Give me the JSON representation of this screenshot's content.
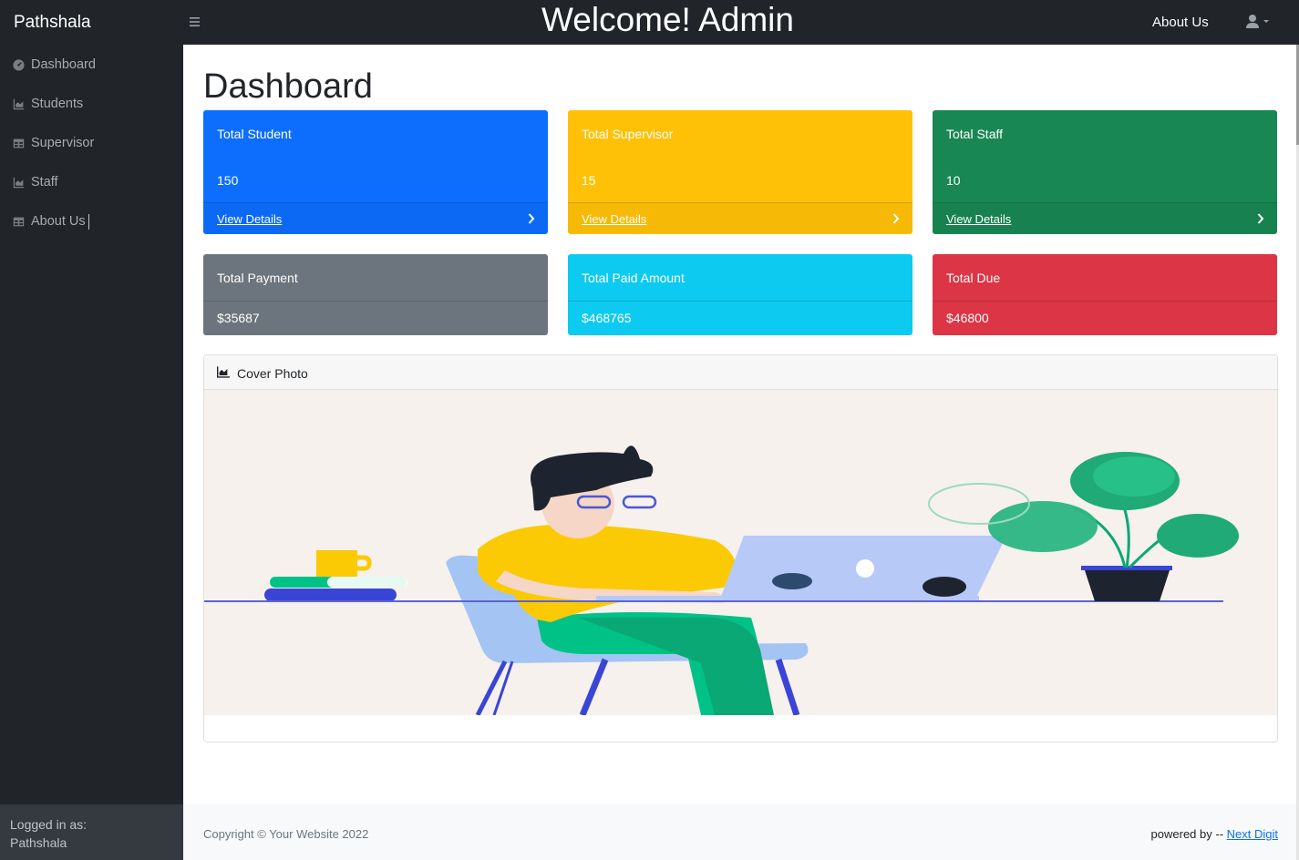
{
  "navbar": {
    "brand": "Pathshala",
    "welcome": "Welcome! Admin",
    "about_link": "About Us"
  },
  "sidebar": {
    "items": [
      {
        "label": "Dashboard",
        "icon": "tachometer-icon"
      },
      {
        "label": "Students",
        "icon": "chart-area-icon"
      },
      {
        "label": "Supervisor",
        "icon": "table-icon"
      },
      {
        "label": "Staff",
        "icon": "chart-area-icon"
      },
      {
        "label": "About Us",
        "icon": "table-icon"
      }
    ],
    "footer_label": "Logged in as:",
    "footer_user": "Pathshala"
  },
  "main": {
    "title": "Dashboard",
    "cards": [
      {
        "title": "Total Student",
        "value": "150",
        "link": "View Details",
        "color": "#0d6efd"
      },
      {
        "title": "Total Supervisor",
        "value": "15",
        "link": "View Details",
        "color": "#ffc107"
      },
      {
        "title": "Total Staff",
        "value": "10",
        "link": "View Details",
        "color": "#198754"
      },
      {
        "title": "Total Payment",
        "value": "$35687",
        "color": "#6c757d"
      },
      {
        "title": "Total Paid Amount",
        "value": "$468765",
        "color": "#0dcaf0"
      },
      {
        "title": "Total Due",
        "value": "$46800",
        "color": "#dc3545"
      }
    ],
    "cover_title": "Cover Photo"
  },
  "footer": {
    "copyright": "Copyright © Your Website 2022",
    "powered_prefix": "powered by -- ",
    "powered_link": "Next Digit"
  }
}
